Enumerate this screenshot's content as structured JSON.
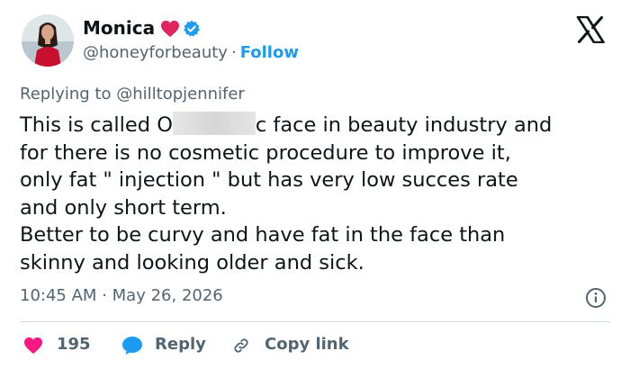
{
  "author": {
    "name": "Monica",
    "handle": "@honeyforbeauty",
    "separator": "·",
    "follow_label": "Follow",
    "avatar_icon": "avatar-photo"
  },
  "icons": {
    "heart_badge": "red-heart-emoji",
    "verified": "verified-badge",
    "platform": "x-logo",
    "info": "info-icon",
    "like": "heart-icon",
    "reply": "speech-bubble-icon",
    "copy_link": "link-icon"
  },
  "colors": {
    "accent": "#1d9bf0",
    "like": "#f91880",
    "text": "#0f1419",
    "muted": "#536471",
    "heart_badge": "#e0245e"
  },
  "tweet": {
    "replying_prefix": "Replying to",
    "replying_to": "@hilltopjennifer",
    "lines": {
      "l1_before": "This is called O",
      "l1_after": "c face in beauty industry and",
      "l2": "for there is no cosmetic procedure to improve it,",
      "l3": "only fat \" injection \" but has  very low succes rate",
      "l4": "and only short term.",
      "l5": "Better to be curvy and have fat in the face than",
      "l6": "skinny and looking older and sick."
    },
    "time": "10:45 AM",
    "separator": "·",
    "date": "May 26, 2026"
  },
  "actions": {
    "like_count": "195",
    "reply_label": "Reply",
    "copy_link_label": "Copy link"
  }
}
